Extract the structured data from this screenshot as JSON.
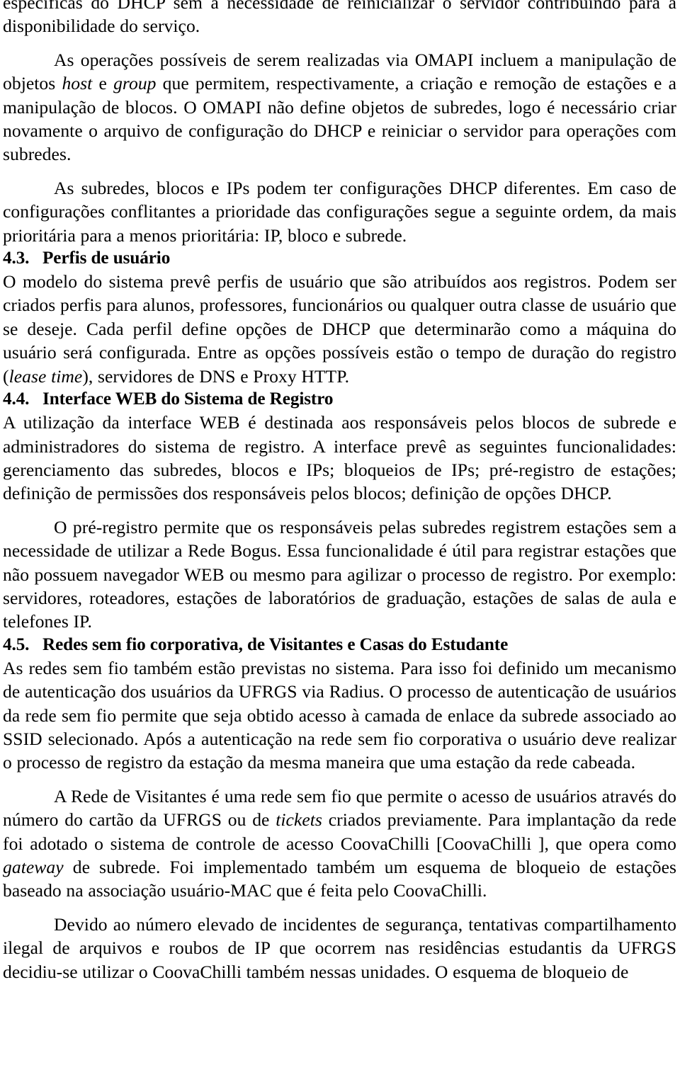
{
  "document": {
    "language": "pt-BR",
    "blocks": [
      {
        "id": "p-continuation-top",
        "type": "paragraph",
        "indent": false,
        "text_plain": "específicas do DHCP sem a necessidade de reinicializar o servidor contribuindo para a disponibilidade do serviço."
      },
      {
        "id": "p-omapi",
        "type": "paragraph",
        "indent": true,
        "text_plain": "As operações possíveis de serem realizadas via OMAPI incluem a manipulação de objetos host e group que permitem, respectivamente, a criação e remoção de estações e a manipulação de blocos. O OMAPI não define objetos de subredes, logo é necessário criar novamente o arquivo de configuração do DHCP e reiniciar o servidor para operações com subredes.",
        "italic_terms": [
          "host",
          "group"
        ]
      },
      {
        "id": "p-prioridade",
        "type": "paragraph",
        "indent": true,
        "text_plain": "As subredes, blocos e IPs podem ter configurações DHCP diferentes. Em caso de configurações conflitantes a prioridade das configurações segue a seguinte ordem, da mais prioritária para a menos prioritária: IP, bloco e subrede."
      },
      {
        "id": "h-4-3",
        "type": "heading",
        "number": "4.3.",
        "title": "Perfis de usuário"
      },
      {
        "id": "p-perfis",
        "type": "paragraph",
        "indent": false,
        "text_plain": "O modelo do sistema prevê perfis de usuário que são atribuídos aos registros. Podem ser criados perfis para alunos, professores, funcionários ou qualquer outra classe de usuário que se deseje. Cada perfil define opções de DHCP que determinarão como a máquina do usuário será configurada. Entre as opções possíveis estão o tempo de duração do registro (lease time), servidores de DNS e Proxy HTTP.",
        "italic_terms": [
          "lease time"
        ]
      },
      {
        "id": "h-4-4",
        "type": "heading",
        "number": "4.4.",
        "title": "Interface WEB do Sistema de Registro"
      },
      {
        "id": "p-interface-web",
        "type": "paragraph",
        "indent": false,
        "text_plain": "A utilização da interface WEB é destinada aos responsáveis pelos blocos de subrede e administradores do sistema de registro. A interface prevê as seguintes funcionalidades: gerenciamento das subredes, blocos e IPs; bloqueios de IPs; pré-registro de estações; definição de permissões dos responsáveis pelos blocos; definição de opções DHCP."
      },
      {
        "id": "p-pre-registro",
        "type": "paragraph",
        "indent": true,
        "text_plain": "O pré-registro permite que os responsáveis pelas subredes registrem estações sem a necessidade de utilizar a Rede Bogus. Essa funcionalidade é útil para registrar estações que não possuem navegador WEB ou mesmo para agilizar o processo de registro. Por exemplo: servidores, roteadores, estações de laboratórios de graduação, estações de salas de aula e telefones IP."
      },
      {
        "id": "h-4-5",
        "type": "heading",
        "number": "4.5.",
        "title": "Redes sem fio corporativa, de Visitantes e Casas do Estudante"
      },
      {
        "id": "p-redes-sem-fio",
        "type": "paragraph",
        "indent": false,
        "text_plain": "As redes sem fio também estão previstas no sistema. Para isso foi definido um mecanismo de autenticação dos usuários da UFRGS via Radius. O processo de autenticação de usuários da rede sem fio permite que seja obtido acesso à camada de enlace da subrede associado ao SSID selecionado. Após a autenticação na rede sem fio corporativa o usuário deve realizar o processo de registro da estação da mesma maneira que uma estação da rede cabeada."
      },
      {
        "id": "p-rede-visitantes",
        "type": "paragraph",
        "indent": true,
        "text_plain": "A Rede de Visitantes é uma rede sem fio que permite o acesso de usuários através do número do cartão da UFRGS ou de tickets criados previamente. Para implantação da rede foi adotado o sistema de controle de acesso CoovaChilli [CoovaChilli ], que opera como gateway de subrede. Foi implementado também um esquema de bloqueio de estações baseado na associação usuário-MAC que é feita pelo CoovaChilli.",
        "italic_terms": [
          "tickets",
          "gateway"
        ],
        "citations": [
          "CoovaChilli "
        ]
      },
      {
        "id": "p-incidentes",
        "type": "paragraph",
        "indent": true,
        "text_plain": "Devido ao número elevado de incidentes de segurança, tentativas compartilhamento ilegal de arquivos e roubos de IP que ocorrem nas residências estudantis da UFRGS decidiu-se utilizar o CoovaChilli também nessas unidades. O esquema de bloqueio de"
      }
    ]
  },
  "colors": {
    "page_background": "#ffffff",
    "text": "#000000"
  },
  "lines": {
    "p-continuation-top": [
      "específicas do DHCP sem a necessidade de reinicializar o servidor contribuindo para a",
      "disponibilidade do serviço."
    ],
    "p-omapi": [
      "As operações possíveis de serem realizadas via OMAPI incluem a manipulação",
      "de objetos host e group que permitem, respectivamente, a criação e remoção de estações",
      "e a manipulação de blocos. O OMAPI não define objetos de subredes, logo é necessário",
      "criar novamente o arquivo de configuração do DHCP e reiniciar o servidor para operações",
      "com subredes."
    ],
    "p-prioridade": [
      "As subredes, blocos e IPs podem ter configurações DHCP diferentes. Em caso",
      "de configurações conflitantes a prioridade das configurações segue a seguinte ordem, da",
      "mais prioritária para a menos prioritária: IP, bloco e subrede."
    ],
    "p-perfis": [
      "O modelo do sistema prevê perfis de usuário que são atribuídos aos registros. Podem ser",
      "criados perfis para alunos, professores, funcionários ou qualquer outra classe de usuário",
      "que se deseje. Cada perfil define opções de DHCP que determinarão como a máquina do",
      "usuário será configurada. Entre as opções possíveis estão o tempo de duração do registro",
      "(lease time), servidores de DNS e Proxy HTTP."
    ],
    "p-interface-web": [
      "A utilização da interface WEB é destinada aos responsáveis pelos blocos de subrede e",
      "administradores do sistema de registro. A interface prevê as seguintes funcionalidades:",
      "gerenciamento das subredes, blocos e IPs; bloqueios de IPs; pré-registro de estações;",
      "definição de permissões dos responsáveis pelos blocos; definição de opções DHCP."
    ],
    "p-pre-registro": [
      "O pré-registro permite que os responsáveis pelas subredes registrem estações sem",
      "a necessidade de utilizar a Rede Bogus. Essa funcionalidade é útil para registrar estações",
      "que não possuem navegador WEB ou mesmo para agilizar o processo de registro. Por",
      "exemplo: servidores, roteadores, estações de laboratórios de graduação, estações de salas",
      "de aula e telefones IP."
    ],
    "p-redes-sem-fio": [
      "As redes sem fio também estão previstas no sistema. Para isso foi definido um meca-",
      "nismo de autenticação dos usuários da UFRGS via Radius. O processo de autenticação",
      "de usuários da rede sem fio permite que seja obtido acesso à camada de enlace da subrede",
      "associado ao SSID selecionado. Após a autenticação na rede sem fio corporativa o usuário",
      "deve realizar o processo de registro da estação da mesma maneira que uma estação da rede",
      "cabeada."
    ],
    "p-rede-visitantes": [
      "A Rede de Visitantes é uma rede sem fio que permite o acesso de usuários através",
      "do número do cartão da UFRGS ou de tickets criados previamente. Para implantação",
      "da rede foi adotado o sistema de controle de acesso CoovaChilli [CoovaChilli ], que",
      "opera como gateway de subrede. Foi implementado também um esquema de bloqueio",
      "de estações baseado na associação usuário-MAC que é feita pelo CoovaChilli."
    ],
    "p-incidentes": [
      "Devido ao número elevado de incidentes de segurança, tentativas compartilha-",
      "mento ilegal de arquivos e roubos de IP que ocorrem nas residências estudantis da UFRGS",
      "decidiu-se utilizar o CoovaChilli também nessas unidades. O esquema de bloqueio de"
    ]
  }
}
